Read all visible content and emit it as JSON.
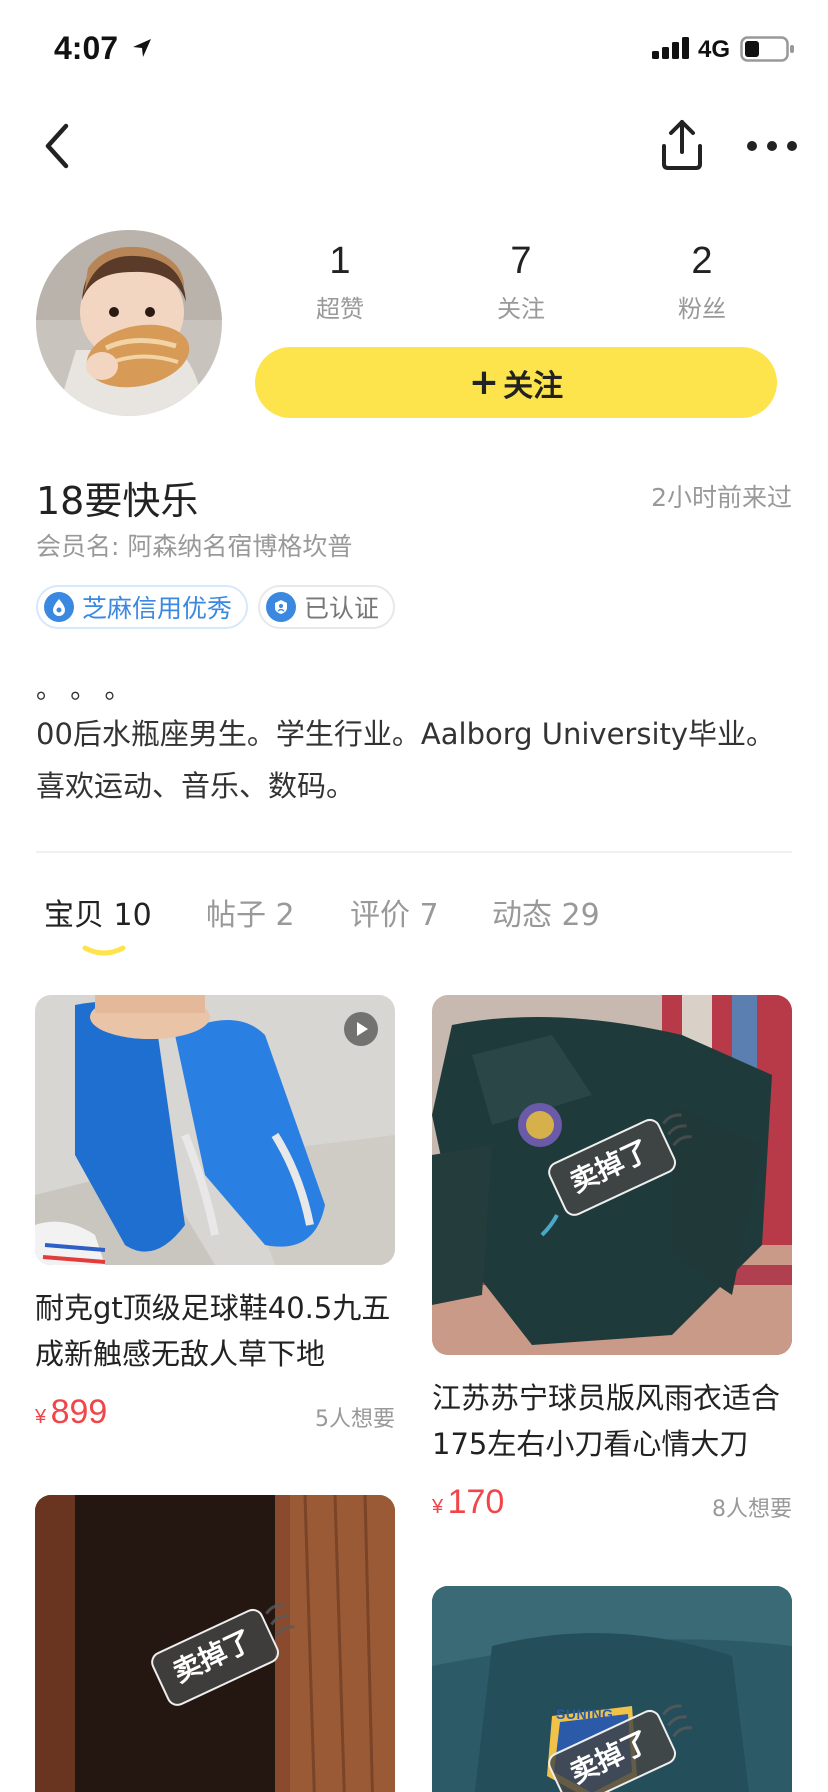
{
  "status_bar": {
    "time": "4:07",
    "network": "4G"
  },
  "profile": {
    "stats": [
      {
        "value": "1",
        "label": "超赞"
      },
      {
        "value": "7",
        "label": "关注"
      },
      {
        "value": "2",
        "label": "粉丝"
      }
    ],
    "follow_label": "关注",
    "username": "18要快乐",
    "last_seen": "2小时前来过",
    "member_name": "会员名: 阿森纳名宿博格坎普",
    "badges": {
      "credit": "芝麻信用优秀",
      "verified": "已认证"
    },
    "bio_dots": "。 。 。",
    "bio": "00后水瓶座男生。学生行业。Aalborg University毕业。喜欢运动、音乐、数码。"
  },
  "tabs": [
    {
      "label": "宝贝",
      "count": "10"
    },
    {
      "label": "帖子",
      "count": "2"
    },
    {
      "label": "评价",
      "count": "7"
    },
    {
      "label": "动态",
      "count": "29"
    }
  ],
  "items": [
    {
      "title": "耐克gt顶级足球鞋40.5九五成新触感无敌人草下地",
      "currency": "¥",
      "price": "899",
      "wants": "5人想要",
      "sold": false,
      "video": true
    },
    {
      "title": "江苏苏宁球员版风雨衣适合175左右小刀看心情大刀",
      "currency": "¥",
      "price": "170",
      "wants": "8人想要",
      "sold": true,
      "sold_label": "卖掉了"
    },
    {
      "sold": true,
      "sold_label": "卖掉了"
    },
    {
      "sold": true,
      "sold_label": "卖掉了",
      "image_text": "SUNING"
    }
  ],
  "colors": {
    "accent_yellow": "#fde44c",
    "price_red": "#f2454a",
    "credit_blue": "#3b88e0"
  }
}
